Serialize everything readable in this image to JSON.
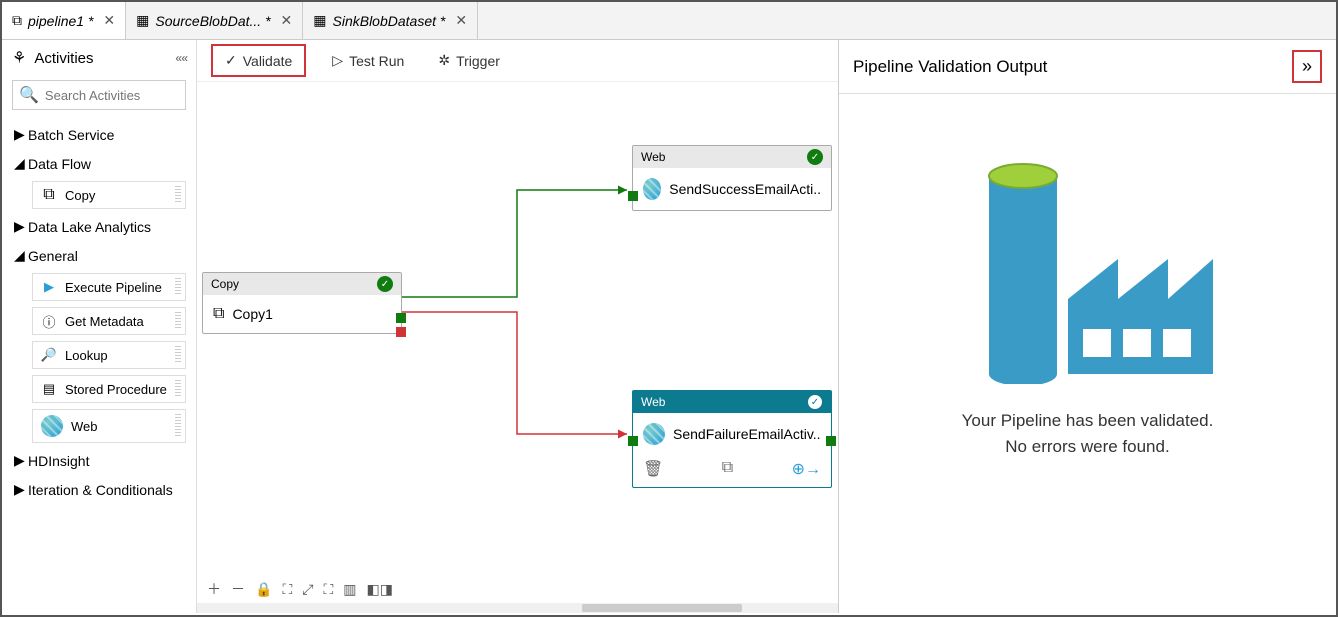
{
  "tabs": [
    {
      "icon": "pipeline",
      "label": "pipeline1 *",
      "active": true
    },
    {
      "icon": "dataset",
      "label": "SourceBlobDat... *",
      "active": false
    },
    {
      "icon": "dataset",
      "label": "SinkBlobDataset *",
      "active": false
    }
  ],
  "sidebar": {
    "title": "Activities",
    "search_placeholder": "Search Activities",
    "categories": {
      "batch": {
        "label": "Batch Service",
        "open": false
      },
      "dataflow": {
        "label": "Data Flow",
        "open": true,
        "items": [
          {
            "label": "Copy",
            "icon": "copy"
          }
        ]
      },
      "dla": {
        "label": "Data Lake Analytics",
        "open": false
      },
      "general": {
        "label": "General",
        "open": true,
        "items": [
          {
            "label": "Execute Pipeline",
            "icon": "exec"
          },
          {
            "label": "Get Metadata",
            "icon": "meta"
          },
          {
            "label": "Lookup",
            "icon": "lookup"
          },
          {
            "label": "Stored Procedure",
            "icon": "sp"
          },
          {
            "label": "Web",
            "icon": "web"
          }
        ]
      },
      "hdi": {
        "label": "HDInsight",
        "open": false
      },
      "iter": {
        "label": "Iteration & Conditionals",
        "open": false
      }
    }
  },
  "toolbar": {
    "validate": "Validate",
    "testrun": "Test Run",
    "trigger": "Trigger"
  },
  "nodes": {
    "copy": {
      "type": "Copy",
      "name": "Copy1"
    },
    "success": {
      "type": "Web",
      "name": "SendSuccessEmailActi.."
    },
    "failure": {
      "type": "Web",
      "name": "SendFailureEmailActiv.."
    }
  },
  "validation": {
    "title": "Pipeline Validation Output",
    "msg1": "Your Pipeline has been validated.",
    "msg2": "No errors were found."
  }
}
